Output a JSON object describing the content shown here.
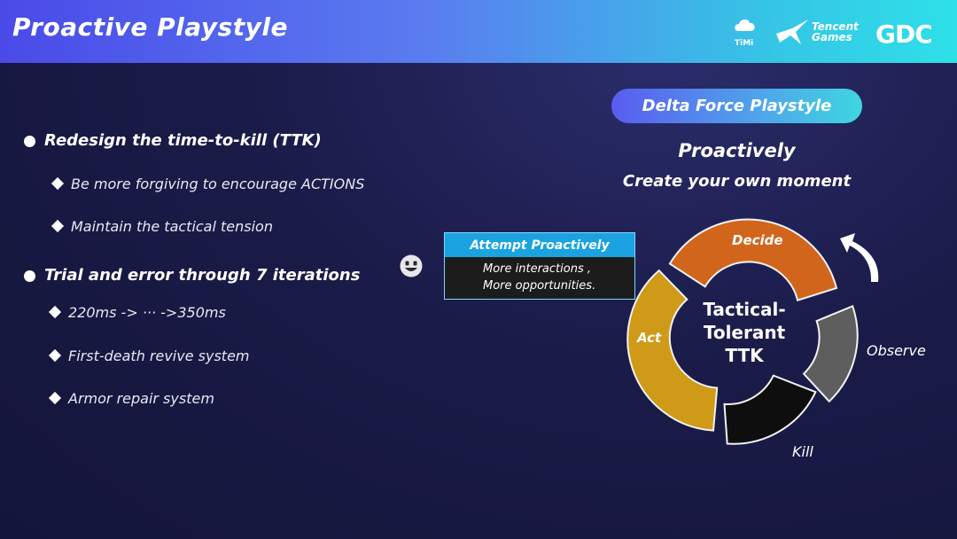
{
  "header": {
    "title": "Proactive Playstyle",
    "logos": {
      "timi": "TiMi",
      "tencent_line1": "Tencent",
      "tencent_line2": "Games",
      "gdc": "GDC"
    }
  },
  "left": {
    "bullet1": "Redesign the time-to-kill (TTK)",
    "bullet1_sub1": "Be more forgiving to encourage ACTIONS",
    "bullet1_sub2": "Maintain the tactical tension",
    "bullet2": "Trial and error through 7 iterations",
    "bullet2_sub1": "220ms -> ··· ->350ms",
    "bullet2_sub2": "First-death revive system",
    "bullet2_sub3": "Armor repair system"
  },
  "right": {
    "pill": "Delta Force Playstyle",
    "heading": "Proactively",
    "subheading": "Create your own moment"
  },
  "attempt": {
    "title": "Attempt Proactively",
    "line1": "More interactions ,",
    "line2": "More opportunities."
  },
  "cycle": {
    "center_line1": "Tactical-",
    "center_line2": "Tolerant",
    "center_line3": "TTK",
    "decide": "Decide",
    "observe": "Observe",
    "kill": "Kill",
    "act": "Act",
    "colors": {
      "decide": "#d2651c",
      "observe": "#5e5e5e",
      "kill": "#0e0e0e",
      "act": "#cf9a17"
    }
  },
  "icons": [
    "smiley-icon",
    "cycle-arrow-icon",
    "timi-logo-icon",
    "tencent-logo-icon"
  ]
}
